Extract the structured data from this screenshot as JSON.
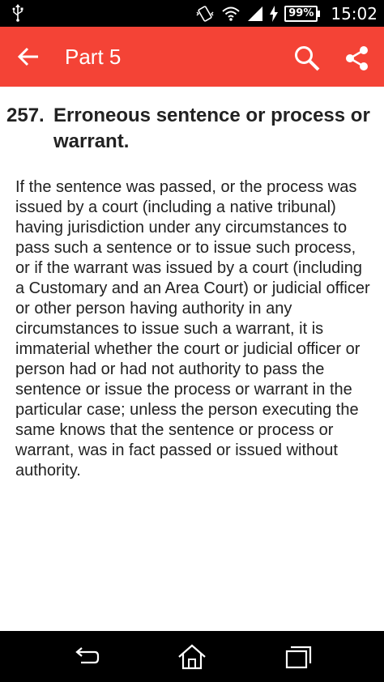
{
  "status_bar": {
    "battery": "99%",
    "time": "15:02",
    "icons": [
      "usb-icon",
      "vibrate-icon",
      "wifi-icon",
      "signal-icon",
      "charging-icon"
    ]
  },
  "app_bar": {
    "title": "Part 5",
    "color": "#f44336",
    "icons": [
      "back-arrow-icon",
      "search-icon",
      "share-icon"
    ]
  },
  "section": {
    "number": "257.",
    "title": "Erroneous sentence or process or warrant.",
    "body": "If the sentence was passed, or the process was issued by a court (including a native tribunal) having jurisdiction under any circumstances to pass such a sentence or to issue such process, or if the warrant was issued by a court (including a Customary and an Area Court) or judicial officer or other person having authority in any circumstances to issue such a warrant, it is immaterial whether the court or judicial officer or person had or had not authority to pass the sentence or issue the process or warrant in the particular case; unless the person executing the same knows that the sentence or process or warrant, was in fact passed or issued without authority."
  },
  "nav_bar": {
    "icons": [
      "back-icon",
      "home-icon",
      "recent-apps-icon"
    ]
  }
}
